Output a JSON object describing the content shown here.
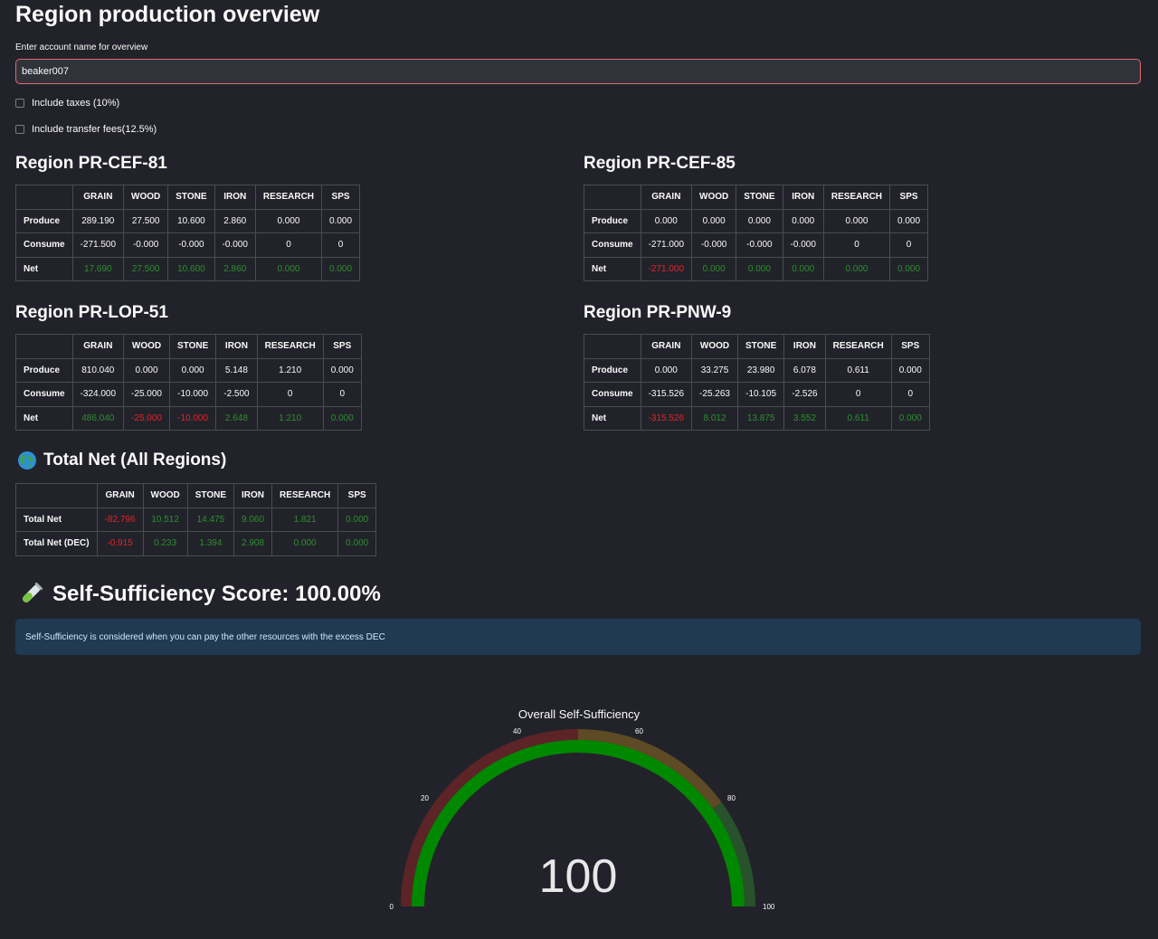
{
  "page": {
    "title": "Region production overview"
  },
  "account": {
    "label": "Enter account name for overview",
    "value": "beaker007"
  },
  "options": {
    "taxes_label": "Include taxes (10%)",
    "fees_label": "Include transfer fees(12.5%)"
  },
  "columns": [
    "GRAIN",
    "WOOD",
    "STONE",
    "IRON",
    "RESEARCH",
    "SPS"
  ],
  "regions": [
    {
      "title": "Region PR-CEF-81",
      "rows": [
        {
          "label": "Produce",
          "cells": [
            {
              "v": "289.190",
              "c": ""
            },
            {
              "v": "27.500",
              "c": ""
            },
            {
              "v": "10.600",
              "c": ""
            },
            {
              "v": "2.860",
              "c": ""
            },
            {
              "v": "0.000",
              "c": ""
            },
            {
              "v": "0.000",
              "c": ""
            }
          ]
        },
        {
          "label": "Consume",
          "cells": [
            {
              "v": "-271.500",
              "c": ""
            },
            {
              "v": "-0.000",
              "c": ""
            },
            {
              "v": "-0.000",
              "c": ""
            },
            {
              "v": "-0.000",
              "c": ""
            },
            {
              "v": "0",
              "c": ""
            },
            {
              "v": "0",
              "c": ""
            }
          ]
        },
        {
          "label": "Net",
          "cells": [
            {
              "v": "17.690",
              "c": "pos"
            },
            {
              "v": "27.500",
              "c": "pos"
            },
            {
              "v": "10.600",
              "c": "pos"
            },
            {
              "v": "2.860",
              "c": "pos"
            },
            {
              "v": "0.000",
              "c": "pos"
            },
            {
              "v": "0.000",
              "c": "pos"
            }
          ]
        }
      ]
    },
    {
      "title": "Region PR-CEF-85",
      "rows": [
        {
          "label": "Produce",
          "cells": [
            {
              "v": "0.000",
              "c": ""
            },
            {
              "v": "0.000",
              "c": ""
            },
            {
              "v": "0.000",
              "c": ""
            },
            {
              "v": "0.000",
              "c": ""
            },
            {
              "v": "0.000",
              "c": ""
            },
            {
              "v": "0.000",
              "c": ""
            }
          ]
        },
        {
          "label": "Consume",
          "cells": [
            {
              "v": "-271.000",
              "c": ""
            },
            {
              "v": "-0.000",
              "c": ""
            },
            {
              "v": "-0.000",
              "c": ""
            },
            {
              "v": "-0.000",
              "c": ""
            },
            {
              "v": "0",
              "c": ""
            },
            {
              "v": "0",
              "c": ""
            }
          ]
        },
        {
          "label": "Net",
          "cells": [
            {
              "v": "-271.000",
              "c": "neg"
            },
            {
              "v": "0.000",
              "c": "pos"
            },
            {
              "v": "0.000",
              "c": "pos"
            },
            {
              "v": "0.000",
              "c": "pos"
            },
            {
              "v": "0.000",
              "c": "pos"
            },
            {
              "v": "0.000",
              "c": "pos"
            }
          ]
        }
      ]
    },
    {
      "title": "Region PR-LOP-51",
      "rows": [
        {
          "label": "Produce",
          "cells": [
            {
              "v": "810.040",
              "c": ""
            },
            {
              "v": "0.000",
              "c": ""
            },
            {
              "v": "0.000",
              "c": ""
            },
            {
              "v": "5.148",
              "c": ""
            },
            {
              "v": "1.210",
              "c": ""
            },
            {
              "v": "0.000",
              "c": ""
            }
          ]
        },
        {
          "label": "Consume",
          "cells": [
            {
              "v": "-324.000",
              "c": ""
            },
            {
              "v": "-25.000",
              "c": ""
            },
            {
              "v": "-10.000",
              "c": ""
            },
            {
              "v": "-2.500",
              "c": ""
            },
            {
              "v": "0",
              "c": ""
            },
            {
              "v": "0",
              "c": ""
            }
          ]
        },
        {
          "label": "Net",
          "cells": [
            {
              "v": "486.040",
              "c": "pos"
            },
            {
              "v": "-25.000",
              "c": "neg"
            },
            {
              "v": "-10.000",
              "c": "neg"
            },
            {
              "v": "2.648",
              "c": "pos"
            },
            {
              "v": "1.210",
              "c": "pos"
            },
            {
              "v": "0.000",
              "c": "pos"
            }
          ]
        }
      ]
    },
    {
      "title": "Region PR-PNW-9",
      "rows": [
        {
          "label": "Produce",
          "cells": [
            {
              "v": "0.000",
              "c": ""
            },
            {
              "v": "33.275",
              "c": ""
            },
            {
              "v": "23.980",
              "c": ""
            },
            {
              "v": "6.078",
              "c": ""
            },
            {
              "v": "0.611",
              "c": ""
            },
            {
              "v": "0.000",
              "c": ""
            }
          ]
        },
        {
          "label": "Consume",
          "cells": [
            {
              "v": "-315.526",
              "c": ""
            },
            {
              "v": "-25.263",
              "c": ""
            },
            {
              "v": "-10.105",
              "c": ""
            },
            {
              "v": "-2.526",
              "c": ""
            },
            {
              "v": "0",
              "c": ""
            },
            {
              "v": "0",
              "c": ""
            }
          ]
        },
        {
          "label": "Net",
          "cells": [
            {
              "v": "-315.526",
              "c": "neg"
            },
            {
              "v": "8.012",
              "c": "pos"
            },
            {
              "v": "13.875",
              "c": "pos"
            },
            {
              "v": "3.552",
              "c": "pos"
            },
            {
              "v": "0.611",
              "c": "pos"
            },
            {
              "v": "0.000",
              "c": "pos"
            }
          ]
        }
      ]
    }
  ],
  "total": {
    "icon": "globe-icon",
    "title": "Total Net (All Regions)",
    "rows": [
      {
        "label": "Total Net",
        "cells": [
          {
            "v": "-82.796",
            "c": "neg"
          },
          {
            "v": "10.512",
            "c": "pos"
          },
          {
            "v": "14.475",
            "c": "pos"
          },
          {
            "v": "9.060",
            "c": "pos"
          },
          {
            "v": "1.821",
            "c": "pos"
          },
          {
            "v": "0.000",
            "c": "pos"
          }
        ]
      },
      {
        "label": "Total Net (DEC)",
        "cells": [
          {
            "v": "-0.915",
            "c": "neg"
          },
          {
            "v": "0.233",
            "c": "pos"
          },
          {
            "v": "1.394",
            "c": "pos"
          },
          {
            "v": "2.908",
            "c": "pos"
          },
          {
            "v": "0.000",
            "c": "pos"
          },
          {
            "v": "0.000",
            "c": "pos"
          }
        ]
      }
    ]
  },
  "score": {
    "icon": "test-tube-icon",
    "title": "Self-Sufficiency Score: 100.00%",
    "info": "Self-Sufficiency is considered when you can pay the other resources with the excess DEC"
  },
  "gauge": {
    "title": "Overall Self-Sufficiency",
    "value": 100,
    "value_text": "100",
    "min": 0,
    "max": 100,
    "ticks": [
      0,
      20,
      40,
      60,
      80,
      100
    ],
    "tick_labels": [
      "0",
      "20",
      "40",
      "60",
      "80",
      "100"
    ],
    "steps": [
      {
        "from": 0,
        "to": 50,
        "color": "#5c2427"
      },
      {
        "from": 50,
        "to": 80,
        "color": "#5e4a24"
      },
      {
        "from": 80,
        "to": 100,
        "color": "#27522b"
      }
    ],
    "bar_color": "#008800"
  }
}
